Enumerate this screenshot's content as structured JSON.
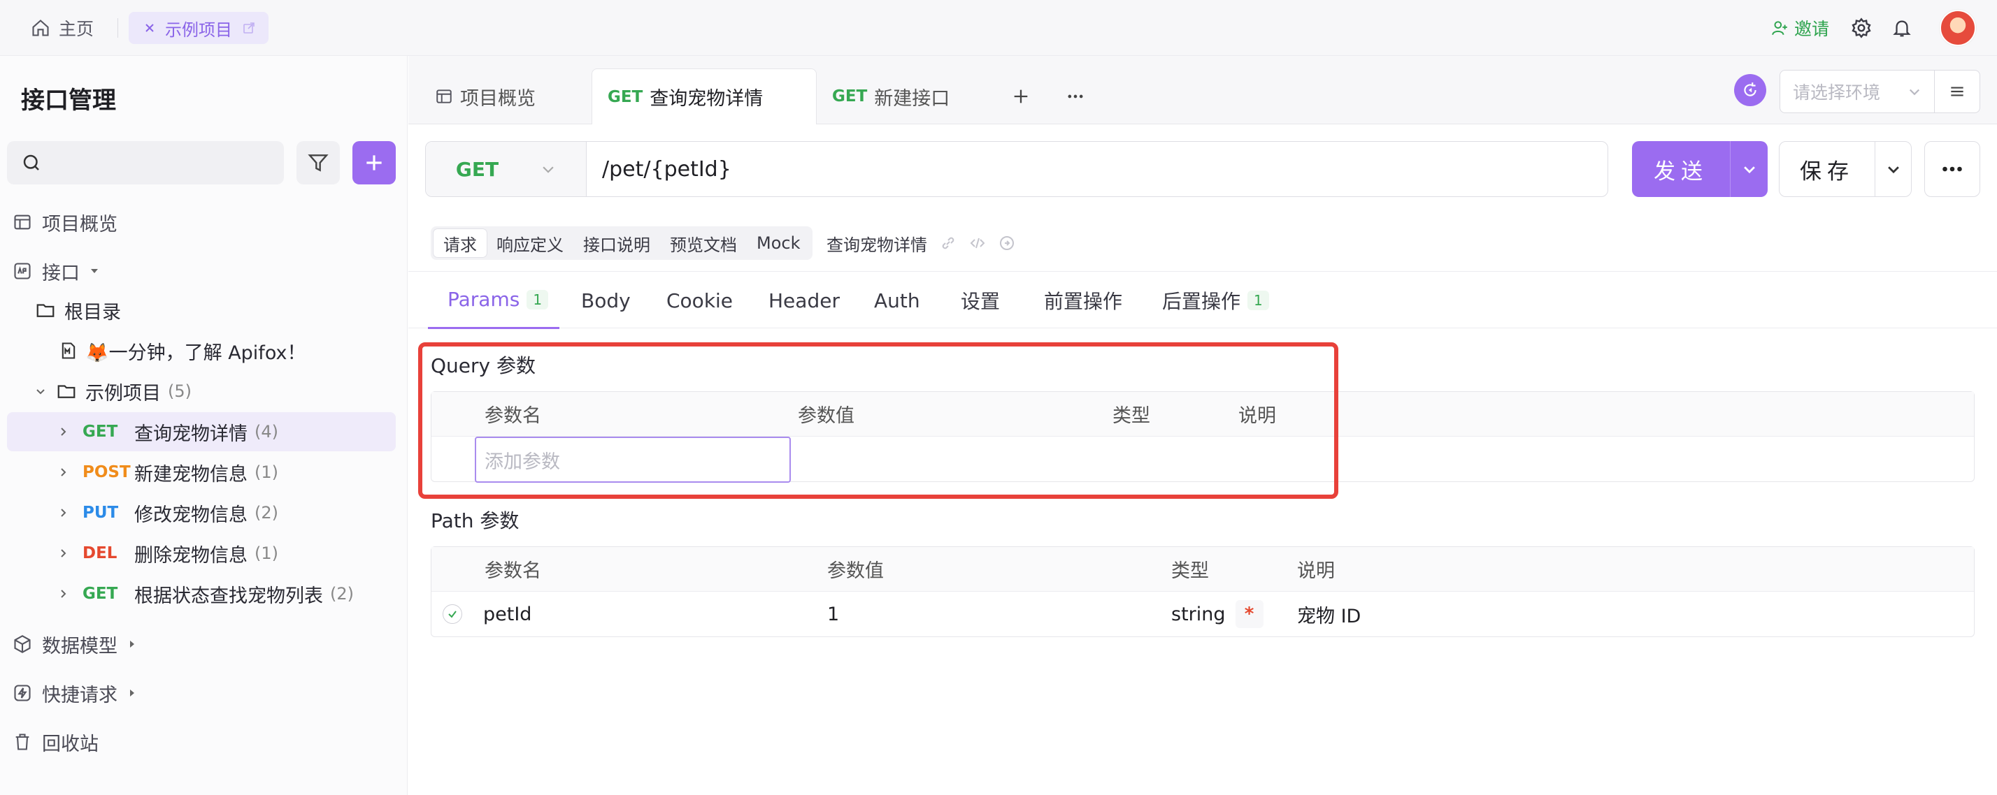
{
  "topbar": {
    "home_label": "主页",
    "project_tab_label": "示例项目",
    "invite_label": "邀请"
  },
  "sidebar": {
    "title": "接口管理",
    "nav": {
      "overview": "项目概览",
      "interfaces": "接口",
      "data_models": "数据模型",
      "quick_requests": "快捷请求",
      "recycle_bin": "回收站"
    },
    "tree": {
      "root": "根目录",
      "intro_doc": "🦊一分钟，了解 Apifox！",
      "group_name": "示例项目",
      "group_count": "(5)",
      "endpoints": [
        {
          "method": "GET",
          "name": "查询宠物详情",
          "count": "(4)"
        },
        {
          "method": "POST",
          "name": "新建宠物信息",
          "count": "(1)"
        },
        {
          "method": "PUT",
          "name": "修改宠物信息",
          "count": "(2)"
        },
        {
          "method": "DEL",
          "name": "删除宠物信息",
          "count": "(1)"
        },
        {
          "method": "GET",
          "name": "根据状态查找宠物列表",
          "count": "(2)"
        }
      ]
    }
  },
  "tabs": [
    {
      "method": "",
      "label": "项目概览"
    },
    {
      "method": "GET",
      "label": "查询宠物详情"
    },
    {
      "method": "GET",
      "label": "新建接口"
    }
  ],
  "env": {
    "placeholder": "请选择环境"
  },
  "request": {
    "method": "GET",
    "url": "/pet/{petId}",
    "send_label": "发送",
    "save_label": "保存"
  },
  "subtabs": [
    "请求",
    "响应定义",
    "接口说明",
    "预览文档",
    "Mock"
  ],
  "api_name": "查询宠物详情",
  "param_tabs": [
    {
      "label": "Params",
      "badge": "1"
    },
    {
      "label": "Body",
      "badge": ""
    },
    {
      "label": "Cookie",
      "badge": ""
    },
    {
      "label": "Header",
      "badge": ""
    },
    {
      "label": "Auth",
      "badge": ""
    },
    {
      "label": "设置",
      "badge": ""
    },
    {
      "label": "前置操作",
      "badge": ""
    },
    {
      "label": "后置操作",
      "badge": "1"
    }
  ],
  "query": {
    "title": "Query 参数",
    "headers": [
      "参数名",
      "参数值",
      "类型",
      "说明"
    ],
    "add_placeholder": "添加参数"
  },
  "path": {
    "title": "Path 参数",
    "headers": [
      "参数名",
      "参数值",
      "类型",
      "说明"
    ],
    "rows": [
      {
        "name": "petId",
        "value": "1",
        "type": "string",
        "required_mark": "*",
        "desc": "宠物 ID"
      }
    ]
  },
  "colors": {
    "accent": "#9b6cf0",
    "get": "#36a852",
    "post": "#f08c1b",
    "put": "#2c8be8",
    "del": "#e5492f",
    "highlight": "#e8413a"
  }
}
